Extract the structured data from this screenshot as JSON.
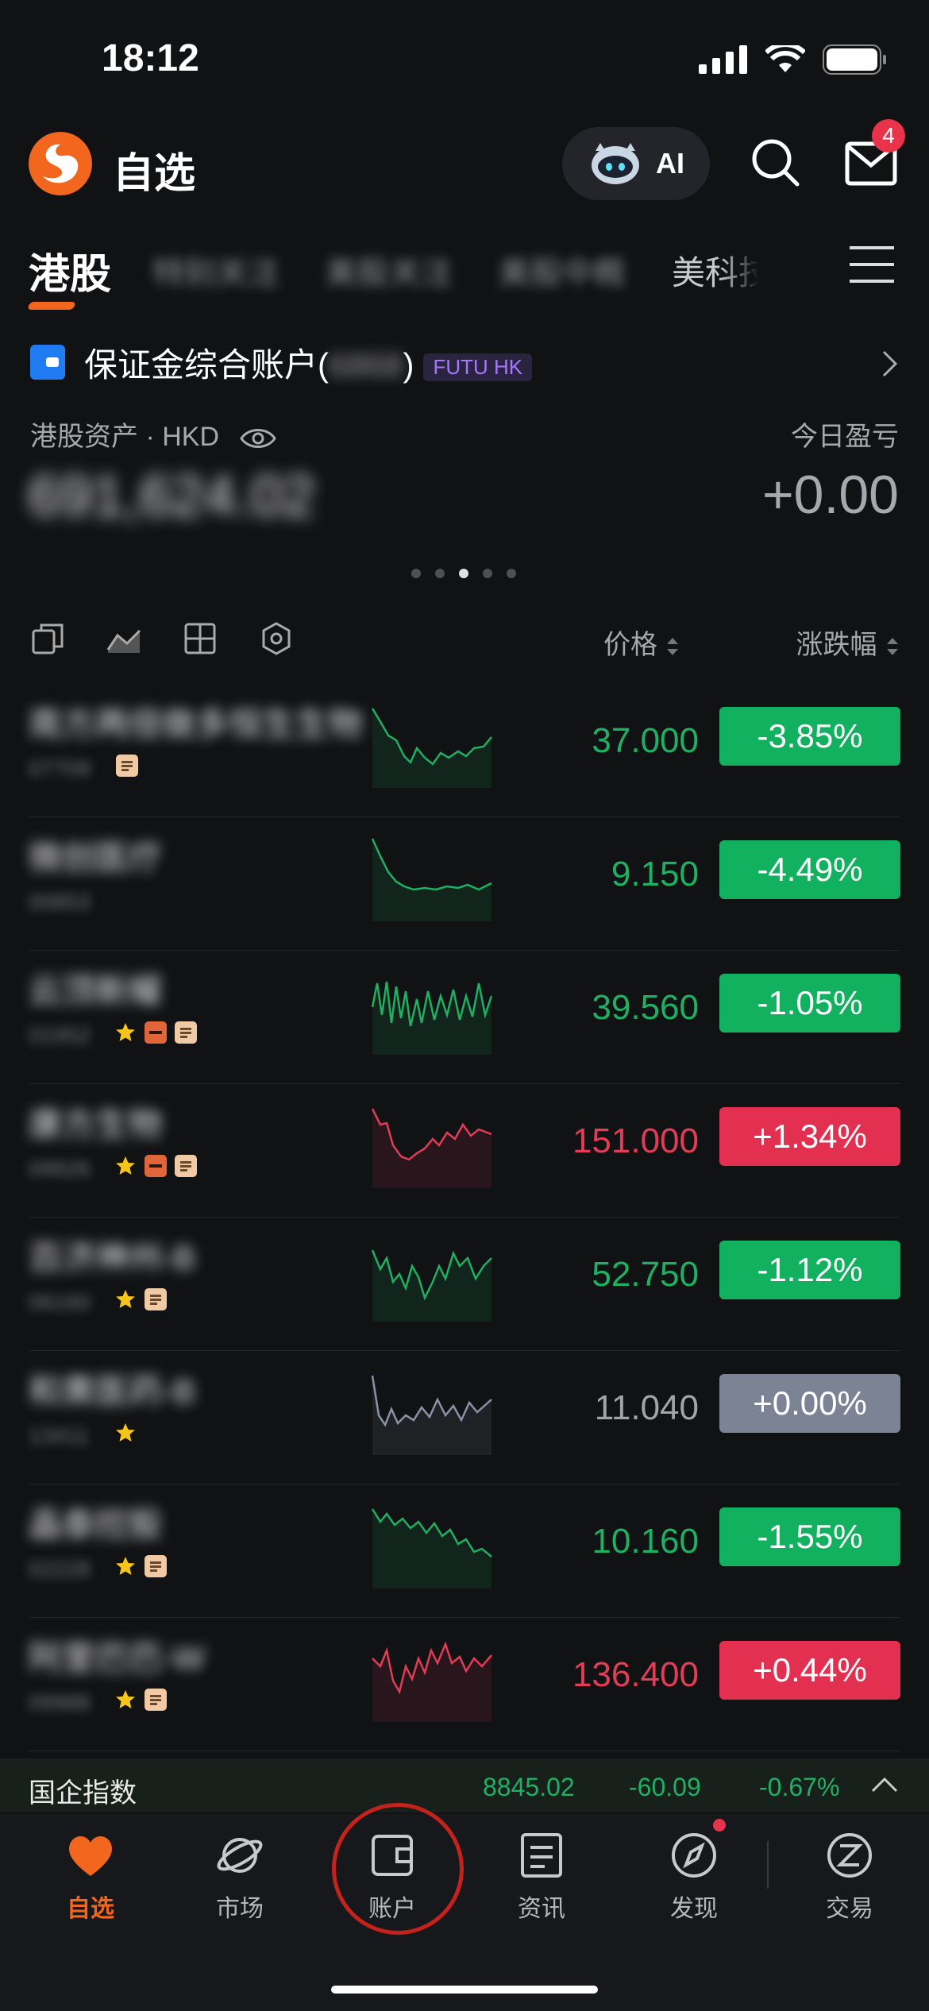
{
  "status": {
    "time": "18:12"
  },
  "header": {
    "title": "自选",
    "ai_label": "AI",
    "mail_badge": "4"
  },
  "tabs": [
    {
      "label": "港股",
      "active": true
    },
    {
      "label": "特别关注",
      "blurred": true
    },
    {
      "label": "美股关注",
      "blurred": true
    },
    {
      "label": "美股中概",
      "blurred": true
    },
    {
      "label": "美科技",
      "faded": true
    }
  ],
  "account": {
    "name_prefix": "保证金综合账户(",
    "name_masked": "6868",
    "name_suffix": ")",
    "tag": "FUTU HK",
    "assets_label": "港股资产 · HKD",
    "assets_value": "691,624.02",
    "pl_label": "今日盈亏",
    "pl_value": "+0.00"
  },
  "table": {
    "price_header": "价格",
    "change_header": "涨跌幅"
  },
  "rows": [
    {
      "name": "南方两倍做多恒生生物",
      "code": "07709",
      "price": "37.000",
      "change": "-3.85%",
      "tone": "green",
      "icons": [
        "doc"
      ]
    },
    {
      "name": "微创医疗",
      "code": "00853",
      "price": "9.150",
      "change": "-4.49%",
      "tone": "green",
      "icons": []
    },
    {
      "name": "云顶新耀",
      "code": "01952",
      "price": "39.560",
      "change": "-1.05%",
      "tone": "green",
      "icons": [
        "star",
        "minus",
        "doc"
      ]
    },
    {
      "name": "康方生物",
      "code": "09926",
      "price": "151.000",
      "change": "+1.34%",
      "tone": "red",
      "icons": [
        "star",
        "minus",
        "doc"
      ]
    },
    {
      "name": "百济神州-B",
      "code": "06160",
      "price": "52.750",
      "change": "-1.12%",
      "tone": "green",
      "icons": [
        "star",
        "doc"
      ]
    },
    {
      "name": "和黄医药-B",
      "code": "13411",
      "price": "11.040",
      "change": "+0.00%",
      "tone": "gray",
      "icons": [
        "star"
      ]
    },
    {
      "name": "晶泰控股",
      "code": "02228",
      "price": "10.160",
      "change": "-1.55%",
      "tone": "green",
      "icons": [
        "star",
        "doc"
      ]
    },
    {
      "name": "阿里巴巴-W",
      "code": "09988",
      "price": "136.400",
      "change": "+0.44%",
      "tone": "red",
      "icons": [
        "star",
        "doc"
      ]
    }
  ],
  "index": {
    "name": "国企指数",
    "value": "8845.02",
    "change": "-60.09",
    "percent": "-0.67%"
  },
  "nav": [
    {
      "label": "自选",
      "icon": "heart-icon",
      "active": true
    },
    {
      "label": "市场",
      "icon": "planet-icon"
    },
    {
      "label": "账户",
      "icon": "wallet-icon"
    },
    {
      "label": "资讯",
      "icon": "news-icon"
    },
    {
      "label": "发现",
      "icon": "compass-icon"
    },
    {
      "label": "交易",
      "icon": "trade-icon"
    }
  ],
  "colors": {
    "accent": "#f2661d",
    "up": "#e32f50",
    "down": "#12b15f",
    "flat": "#7b8394"
  }
}
